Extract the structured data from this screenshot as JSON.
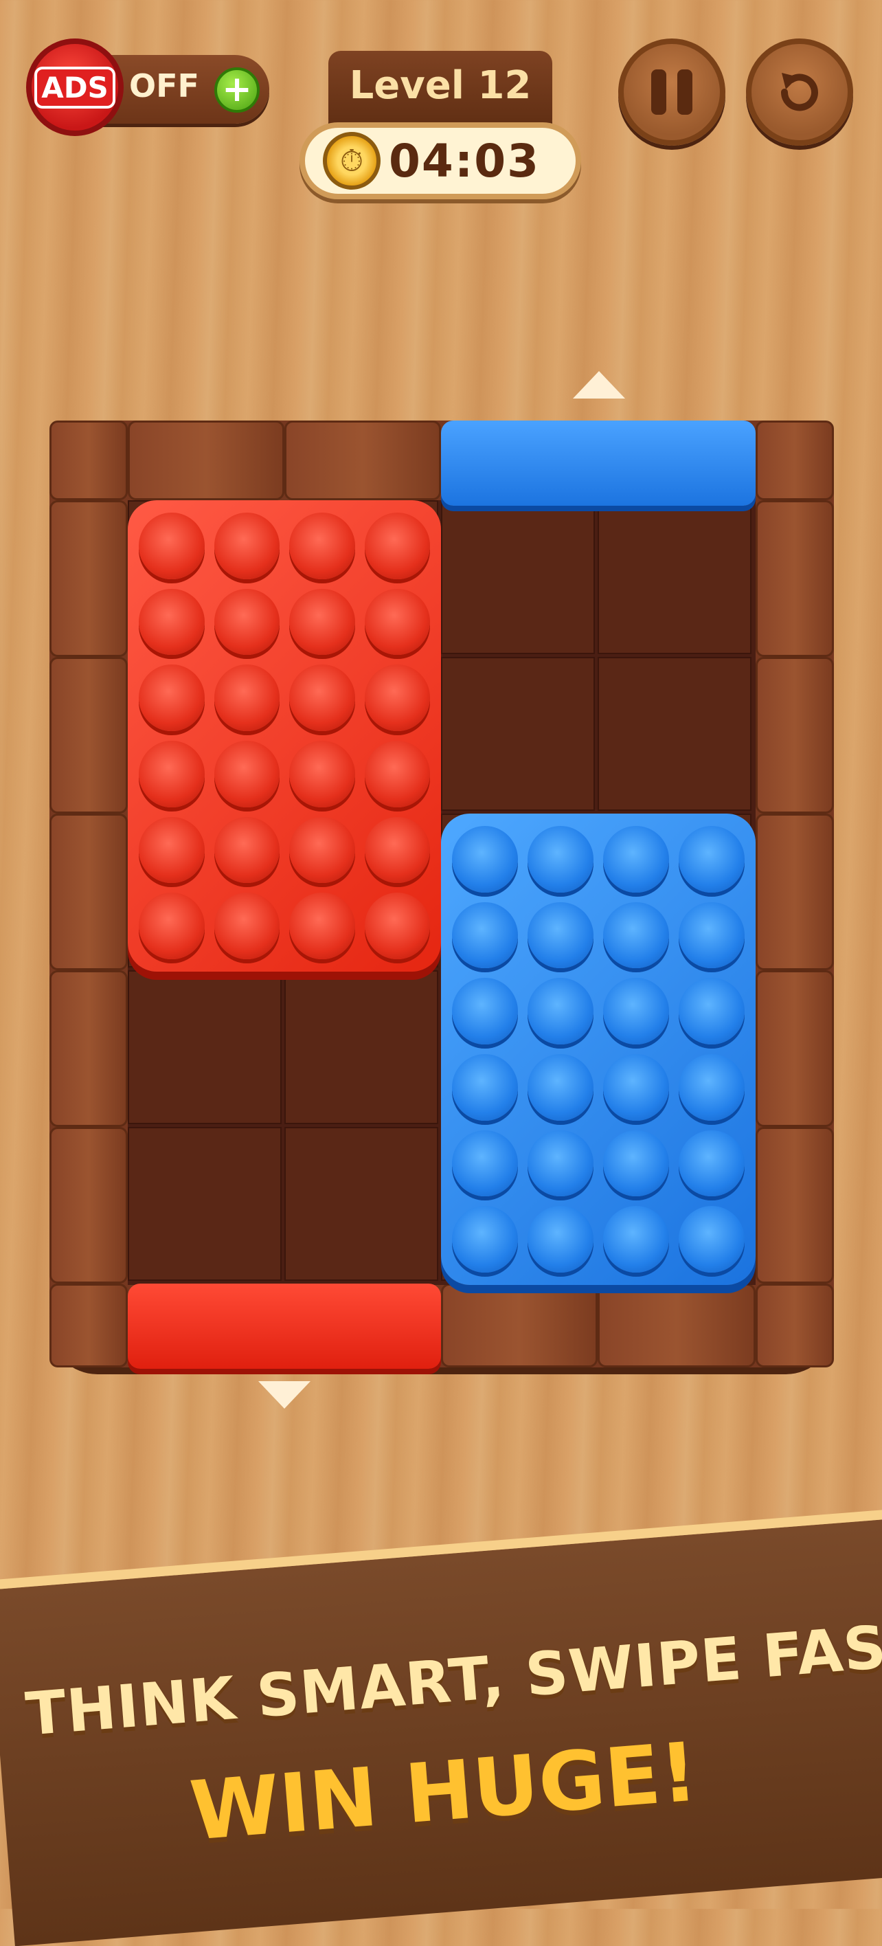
{
  "hud": {
    "ads_badge": "ADS",
    "ads_status": "OFF",
    "plus": "+",
    "level": "Level 12",
    "timer": "04:03"
  },
  "board": {
    "gates": [
      {
        "color": "blue",
        "edge": "top"
      },
      {
        "color": "red",
        "edge": "bottom"
      }
    ],
    "blocks": [
      {
        "color": "red",
        "studs": 24
      },
      {
        "color": "blue",
        "studs": 24
      }
    ],
    "arrows": [
      "up",
      "down"
    ]
  },
  "colors": {
    "red": "#e52611",
    "blue": "#1b73df",
    "wood": "#75371f"
  },
  "tagline": {
    "line1": "THINK SMART, SWIPE FAST,",
    "line2": "WIN HUGE!"
  }
}
